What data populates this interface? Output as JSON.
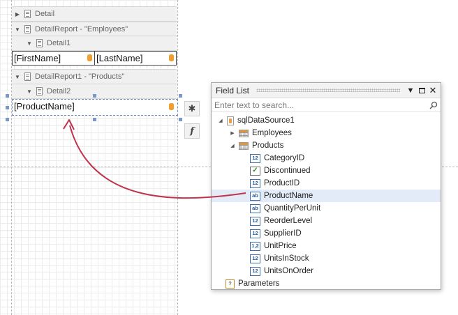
{
  "designer": {
    "bands": [
      {
        "label": "Detail",
        "expanded": false
      },
      {
        "label": "DetailReport - \"Employees\"",
        "expanded": true
      },
      {
        "label": "Detail1",
        "expanded": true
      },
      {
        "label": "DetailReport1 - \"Products\"",
        "expanded": true
      },
      {
        "label": "Detail2",
        "expanded": true
      }
    ],
    "cells": {
      "first_name": "[FirstName]",
      "last_name": "[LastName]",
      "product_name": "[ProductName]"
    },
    "side_buttons": {
      "properties_glyph": "✱",
      "expression_glyph": "f"
    }
  },
  "field_list": {
    "title": "Field List",
    "search_placeholder": "Enter text to search...",
    "datasource": "sqlDataSource1",
    "tables": [
      {
        "label": "Employees",
        "expanded": false
      },
      {
        "label": "Products",
        "expanded": true
      }
    ],
    "fields": [
      {
        "label": "CategoryID",
        "type": "12"
      },
      {
        "label": "Discontinued",
        "type": "✓"
      },
      {
        "label": "ProductID",
        "type": "12"
      },
      {
        "label": "ProductName",
        "type": "ab"
      },
      {
        "label": "QuantityPerUnit",
        "type": "ab"
      },
      {
        "label": "ReorderLevel",
        "type": "12"
      },
      {
        "label": "SupplierID",
        "type": "12"
      },
      {
        "label": "UnitPrice",
        "type": "1,2"
      },
      {
        "label": "UnitsInStock",
        "type": "12"
      },
      {
        "label": "UnitsOnOrder",
        "type": "12"
      }
    ],
    "parameters": {
      "label": "Parameters",
      "type": "?"
    },
    "highlighted_field": "ProductName"
  },
  "colors": {
    "arrow": "#c0334d",
    "highlight": "#e2ebf7",
    "field_icon": "#2b5c9a"
  }
}
